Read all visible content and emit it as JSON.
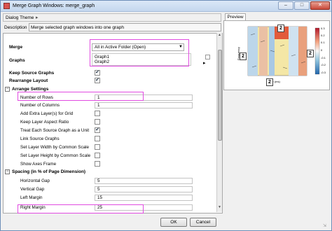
{
  "window": {
    "title": "Merge Graph Windows: merge_graph",
    "minimize": "–",
    "maximize": "□",
    "close": "✕"
  },
  "dialog_theme": {
    "label": "Dialog Theme",
    "arrow": "▸"
  },
  "description": {
    "label": "Description",
    "value": "Merge selected graph windows into one graph"
  },
  "merge": {
    "label": "Merge",
    "value": "All in Active Folder (Open)"
  },
  "graphs": {
    "label": "Graphs",
    "items": [
      "Graph1",
      "Graph2"
    ]
  },
  "keep_source": {
    "label": "Keep Source Graphs",
    "checked": true
  },
  "rearrange": {
    "label": "Rearrange Layout",
    "checked": true
  },
  "arrange": {
    "header": "Arrange Settings",
    "rows": [
      {
        "label": "Number of Rows",
        "value": "1"
      },
      {
        "label": "Number of Columns",
        "value": "1"
      }
    ],
    "checks": [
      {
        "label": "Add Extra Layer(s) for Grid",
        "checked": false
      },
      {
        "label": "Keep Layer Aspect Ratio",
        "checked": false
      },
      {
        "label": "Treat Each Source Graph as a Unit",
        "checked": true
      },
      {
        "label": "Link Source Graphs",
        "checked": false
      },
      {
        "label": "Set Layer Width by Common Scale",
        "checked": false
      },
      {
        "label": "Set Layer Height by Common Scale",
        "checked": false
      },
      {
        "label": "Show Axes Frame",
        "checked": false
      }
    ]
  },
  "spacing": {
    "header": "Spacing (in % of Page Dimension)",
    "rows": [
      {
        "label": "Horizontal Gap",
        "value": "5"
      },
      {
        "label": "Vertical Gap",
        "value": "5"
      },
      {
        "label": "Left Margin",
        "value": "15"
      },
      {
        "label": "Right Margin",
        "value": "25"
      }
    ]
  },
  "buttons": {
    "ok": "OK",
    "cancel": "Cancel"
  },
  "preview": {
    "tab": "Preview",
    "labels": [
      "2",
      "2",
      "2",
      "2"
    ],
    "xlabel": "Time (ms)",
    "ylabel": "Frequency",
    "colorbar": [
      "0.3",
      "0.2",
      "0.1",
      "0",
      "-0.1",
      "-0.2",
      "-0.3"
    ]
  },
  "colors": {
    "highlight": "#e14be1",
    "accent": "#3c6bb5"
  }
}
